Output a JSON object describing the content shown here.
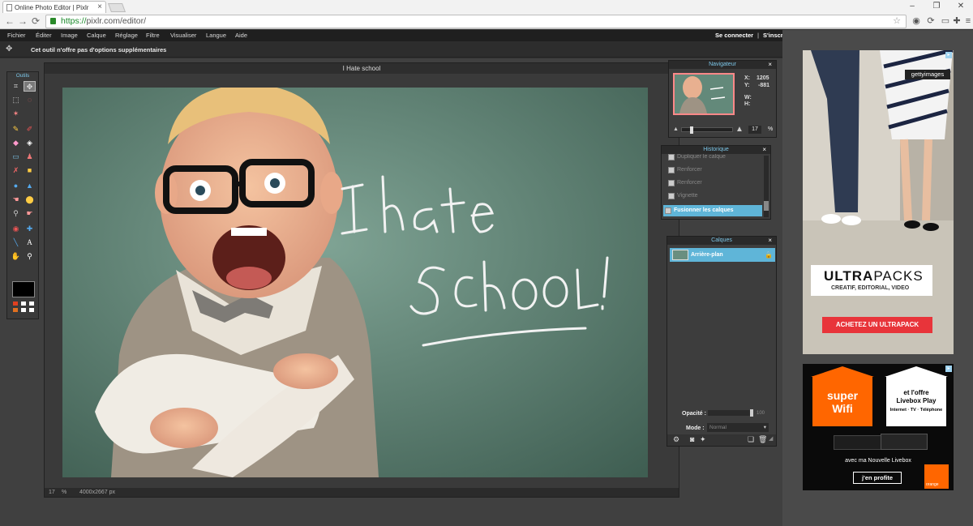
{
  "browser": {
    "tab_title": "Online Photo Editor | Pixlr",
    "tab_close": "×",
    "url_scheme": "https://",
    "url_rest": "pixlr.com/editor/",
    "back": "←",
    "forward": "→",
    "reload": "⟳",
    "star": "☆",
    "ext_icons": [
      "◉",
      "⟳",
      "▭",
      "✚",
      "≡"
    ],
    "win_min": "–",
    "win_max": "❐",
    "win_close": "✕"
  },
  "menubar": {
    "items": [
      "Fichier",
      "Éditer",
      "Image",
      "Calque",
      "Réglage",
      "Filtre",
      "Visualiser",
      "Langue",
      "Aide"
    ],
    "login": "Se connecter",
    "sep": "|",
    "signup": "S'inscr"
  },
  "options_bar": {
    "text": "Cet outil n'offre pas d'options supplémentaires"
  },
  "toolbox": {
    "title": "Outils"
  },
  "document": {
    "title": "I Hate school",
    "zoom": "17",
    "zoom_unit": "%",
    "dimensions": "4000x2667 px",
    "chalk_line1": "I hate",
    "chalk_line2": "SCHOOL!"
  },
  "navigator": {
    "title": "Navigateur",
    "x_label": "X:",
    "x_value": "1205",
    "y_label": "Y:",
    "y_value": "-881",
    "w_label": "W:",
    "h_label": "H:",
    "zoom": "17",
    "zoom_unit": "%",
    "zoom_level_fraction": 0.17
  },
  "history": {
    "title": "Historique",
    "items": [
      "Dupliquer le calque",
      "Renforcer",
      "Renforcer",
      "Vignette",
      "Fusionner les calques"
    ],
    "selected_index": 4
  },
  "layers": {
    "title": "Calques",
    "layer_name": "Arrière-plan",
    "opacity_label": "Opacité :",
    "opacity_value": "100",
    "mode_label": "Mode :",
    "mode_value": "Normal"
  },
  "ads": {
    "ad1": {
      "brand": "gettyimages",
      "headline_bold": "ULTRA",
      "headline_rest": "PACKS",
      "subline": "CREATIF, EDITORIAL, VIDEO",
      "cta": "ACHETEZ UN ULTRAPACK"
    },
    "ad2": {
      "box1_line1": "super",
      "box1_line2": "Wifi",
      "box2_line1": "et l'offre",
      "box2_line2": "Livebox Play",
      "box2_line3": "Internet · TV · Téléphone",
      "caption": "avec ma Nouvelle Livebox",
      "cta": "j'en profite",
      "logo_text": "orange"
    }
  },
  "colors": {
    "accent": "#5fb5d8",
    "panel_title": "#7cc6e8",
    "orange": "#ff6600",
    "ad_cta": "#e8343a"
  }
}
